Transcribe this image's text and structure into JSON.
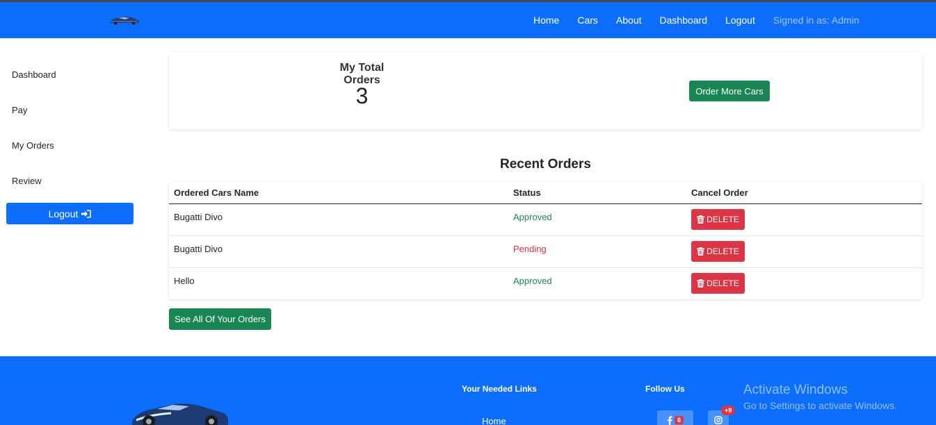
{
  "navbar": {
    "links": [
      "Home",
      "Cars",
      "About",
      "Dashboard",
      "Logout"
    ],
    "signed_in": "Signed in as: Admin"
  },
  "sidebar": {
    "items": [
      "Dashboard",
      "Pay",
      "My Orders",
      "Review"
    ],
    "logout_label": "Logout"
  },
  "summary": {
    "label": "My Total Orders",
    "count": "3",
    "order_more_label": "Order More Cars"
  },
  "recent": {
    "title": "Recent Orders",
    "columns": [
      "Ordered Cars Name",
      "Status",
      "Cancel Order"
    ],
    "rows": [
      {
        "name": "Bugatti Divo",
        "status": "Approved",
        "action": "DELETE"
      },
      {
        "name": "Bugatti Divo",
        "status": "Pending",
        "action": "DELETE"
      },
      {
        "name": "Hello",
        "status": "Approved",
        "action": "DELETE"
      }
    ],
    "see_all_label": "See All Of Your Orders"
  },
  "footer": {
    "links_heading": "Your Needed Links",
    "follow_heading": "Follow Us",
    "links": [
      "Home"
    ],
    "facebook_badge": "8",
    "instagram_badge": "+9"
  },
  "overlay": {
    "title": "Activate Windows",
    "subtitle": "Go to Settings to activate Windows."
  },
  "colors": {
    "primary": "#0d6efd",
    "success": "#198754",
    "danger": "#dc3545",
    "approved_text": "#198754",
    "pending_text": "#dc3545"
  }
}
